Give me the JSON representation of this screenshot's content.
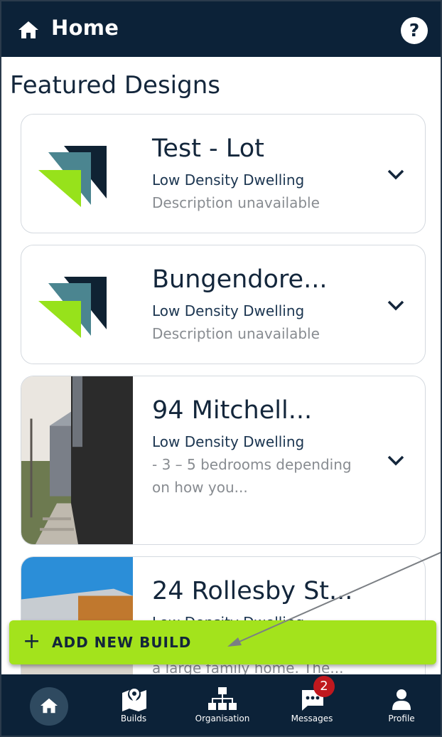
{
  "header": {
    "title": "Home",
    "home_icon": "home-icon",
    "help_label": "?"
  },
  "section_title": "Featured Designs",
  "designs": [
    {
      "name": "Test - Lot",
      "type": "Low Density Dwelling",
      "description": "Description unavailable",
      "image": "logo"
    },
    {
      "name": "Bungendore...",
      "type": "Low Density Dwelling",
      "description": "Description unavailable",
      "image": "logo"
    },
    {
      "name": "94 Mitchell...",
      "type": "Low Density Dwelling",
      "description": "-      3 – 5 bedrooms depending on how you...",
      "image": "photo"
    },
    {
      "name": "24 Rollesby St...",
      "type": "Low Density Dwelling",
      "description": "a large family home. The...",
      "image": "photo"
    }
  ],
  "add_button": {
    "icon": "plus-icon",
    "label": "ADD NEW BUILD"
  },
  "bottom_nav": {
    "items": [
      {
        "label": "",
        "icon": "home-icon",
        "active": true
      },
      {
        "label": "Builds",
        "icon": "map-pin-icon"
      },
      {
        "label": "Organisation",
        "icon": "org-chart-icon"
      },
      {
        "label": "Messages",
        "icon": "chat-icon",
        "badge": "2"
      },
      {
        "label": "Profile",
        "icon": "person-icon"
      }
    ]
  },
  "colors": {
    "primary_dark": "#0c2238",
    "accent_green": "#a3e31c",
    "badge_red": "#c0181e",
    "logo_teal": "#4b8590",
    "logo_green": "#97e21b"
  }
}
